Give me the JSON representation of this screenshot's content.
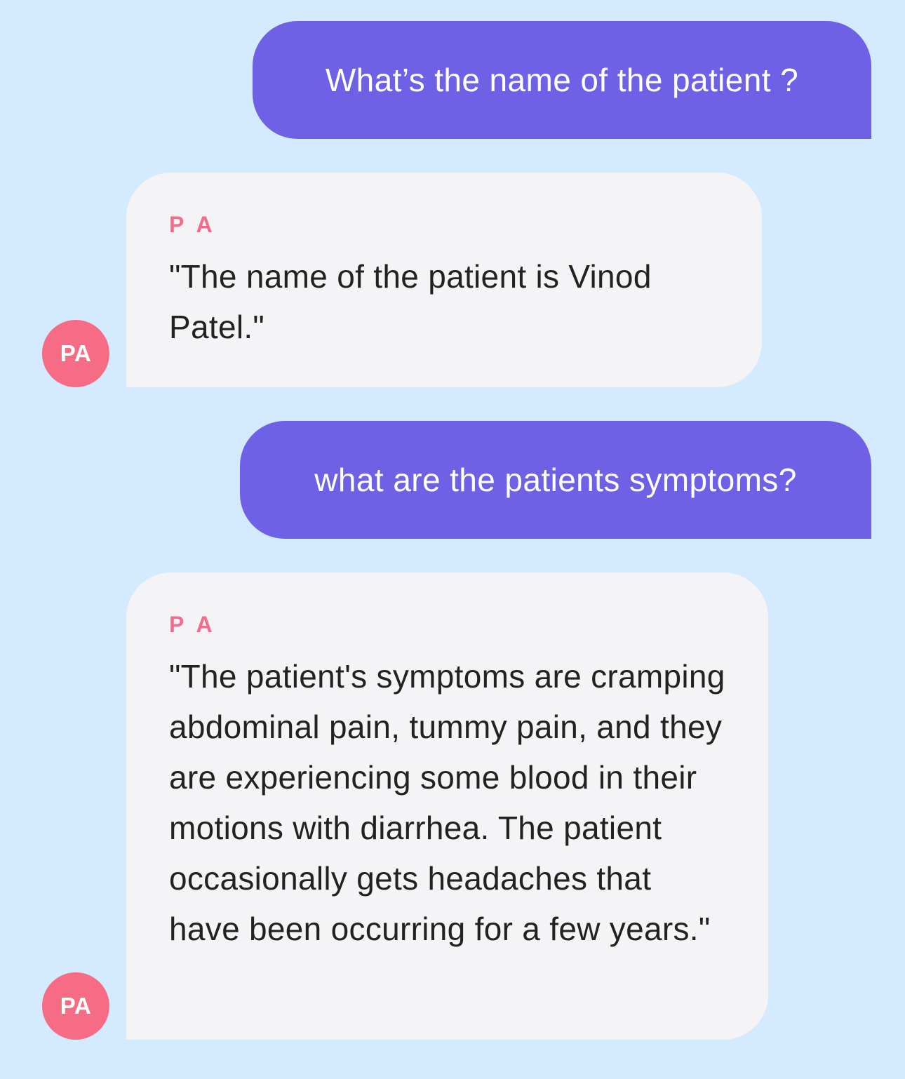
{
  "colors": {
    "background": "#d4eafe",
    "user_bubble": "#6e61e6",
    "bot_bubble": "#f4f4f7",
    "accent": "#f46c8c",
    "avatar": "#f76c85"
  },
  "messages": [
    {
      "role": "user",
      "text": "What’s the name of the patient ?"
    },
    {
      "role": "assistant",
      "sender": "P A",
      "avatar": "PA",
      "text": "\"The name of the patient is Vinod Patel.\""
    },
    {
      "role": "user",
      "text": "what are the patients symptoms?"
    },
    {
      "role": "assistant",
      "sender": "P A",
      "avatar": "PA",
      "text": "\"The patient's symptoms are cramping abdominal pain, tummy pain, and they are experiencing some blood in their motions with diarrhea. The patient occasionally gets headaches that have been occurring for a few years.\""
    }
  ]
}
